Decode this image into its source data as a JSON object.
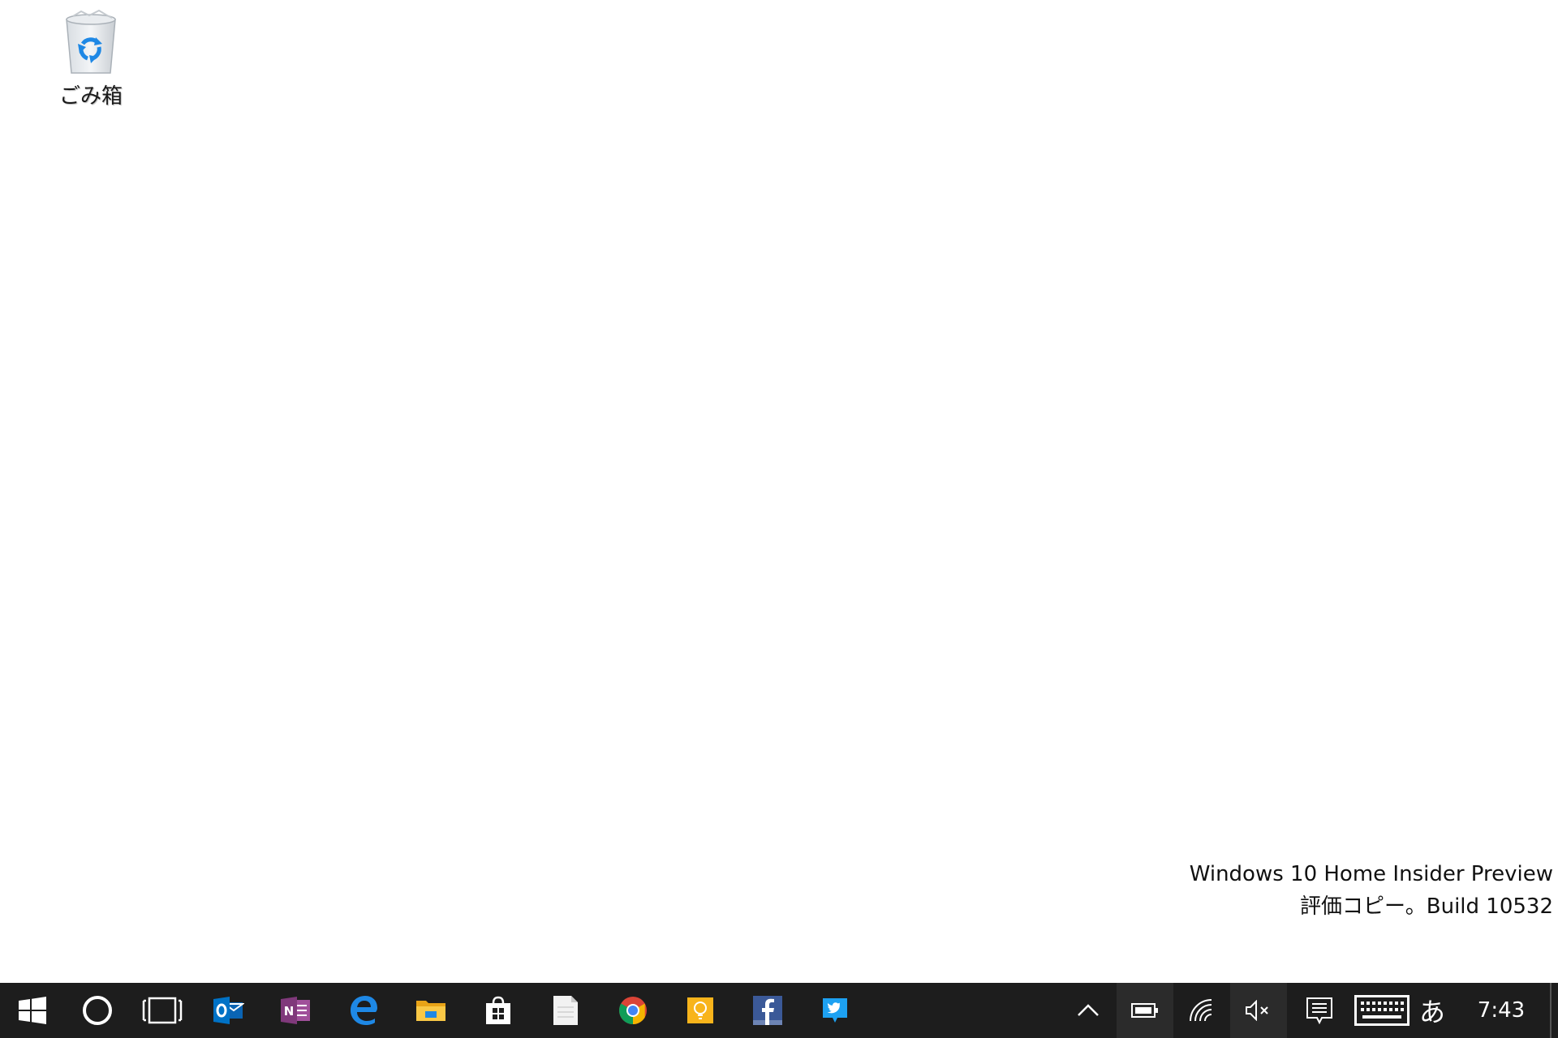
{
  "desktop": {
    "icons": [
      {
        "label": "ごみ箱",
        "icon": "recycle-bin-icon"
      }
    ],
    "watermark": {
      "line1": "Windows 10 Home Insider Preview",
      "line2": "評価コピー。Build 10532"
    }
  },
  "taskbar": {
    "background": "#1d1d1d",
    "start": {
      "icon": "windows-logo-icon"
    },
    "cortana": {
      "icon": "cortana-circle-icon"
    },
    "task_view": {
      "icon": "task-view-icon"
    },
    "pinned": [
      {
        "name": "outlook",
        "icon": "outlook-icon",
        "color": "#0072c6"
      },
      {
        "name": "onenote",
        "icon": "onenote-icon",
        "color": "#80397b"
      },
      {
        "name": "edge",
        "icon": "edge-icon",
        "color": "#1e90ff"
      },
      {
        "name": "file-explorer",
        "icon": "folder-icon",
        "color": "#f5c242"
      },
      {
        "name": "store",
        "icon": "store-icon",
        "color": "#ffffff"
      },
      {
        "name": "notepad",
        "icon": "document-icon",
        "color": "#ffffff"
      },
      {
        "name": "chrome",
        "icon": "chrome-icon",
        "color": "#db4437"
      },
      {
        "name": "tips",
        "icon": "lightbulb-icon",
        "color": "#f8b41b"
      },
      {
        "name": "facebook",
        "icon": "facebook-icon",
        "color": "#3b5998"
      },
      {
        "name": "twitter",
        "icon": "twitter-icon",
        "color": "#1da1f2"
      }
    ],
    "tray": {
      "chevron": "chevron-up-icon",
      "battery": "battery-icon",
      "network": "wifi-icon",
      "volume": "volume-muted-icon",
      "action_center": "action-center-icon",
      "keyboard": "touch-keyboard-icon",
      "ime_label": "あ",
      "clock": "7:43"
    }
  }
}
